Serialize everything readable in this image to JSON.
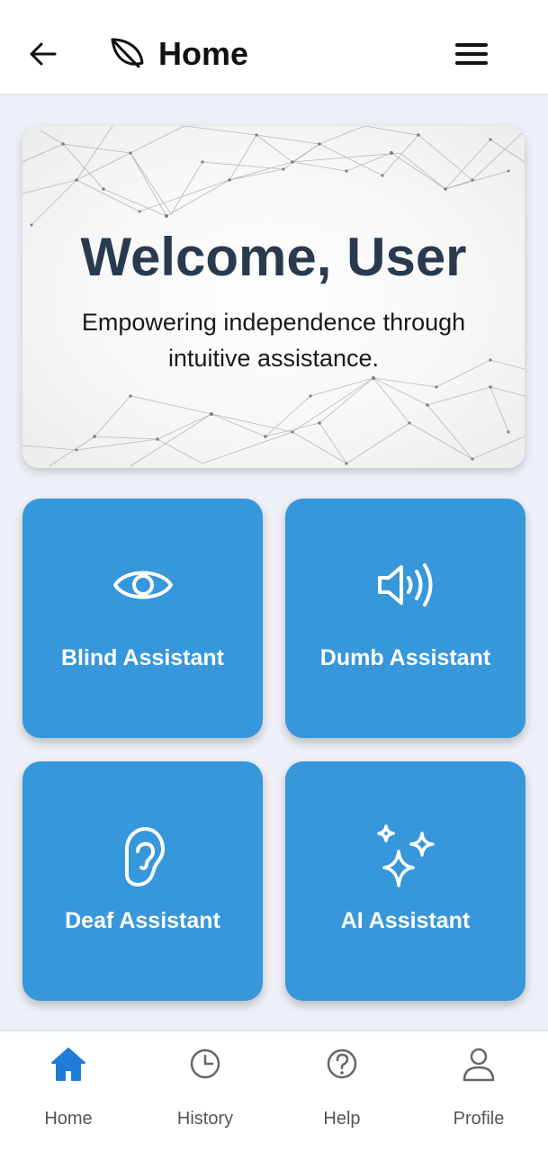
{
  "header": {
    "title": "Home",
    "back_icon": "arrow-left-icon",
    "logo_icon": "leaf-icon",
    "menu_icon": "hamburger-menu-icon"
  },
  "welcome": {
    "title": "Welcome, User",
    "subtitle": "Empowering independence through intuitive assistance."
  },
  "tiles": [
    {
      "label": "Blind Assistant",
      "icon": "eye-icon"
    },
    {
      "label": "Dumb Assistant",
      "icon": "speaker-icon"
    },
    {
      "label": "Deaf Assistant",
      "icon": "ear-icon"
    },
    {
      "label": "AI Assistant",
      "icon": "sparkles-icon"
    }
  ],
  "nav": {
    "items": [
      {
        "label": "Home",
        "icon": "home-icon",
        "active": true
      },
      {
        "label": "History",
        "icon": "clock-icon",
        "active": false
      },
      {
        "label": "Help",
        "icon": "help-icon",
        "active": false
      },
      {
        "label": "Profile",
        "icon": "user-icon",
        "active": false
      }
    ]
  },
  "colors": {
    "tile": "#3797db",
    "active_nav": "#1e7bd8",
    "background": "#edf0f6",
    "title_text": "#2a3a4e"
  }
}
